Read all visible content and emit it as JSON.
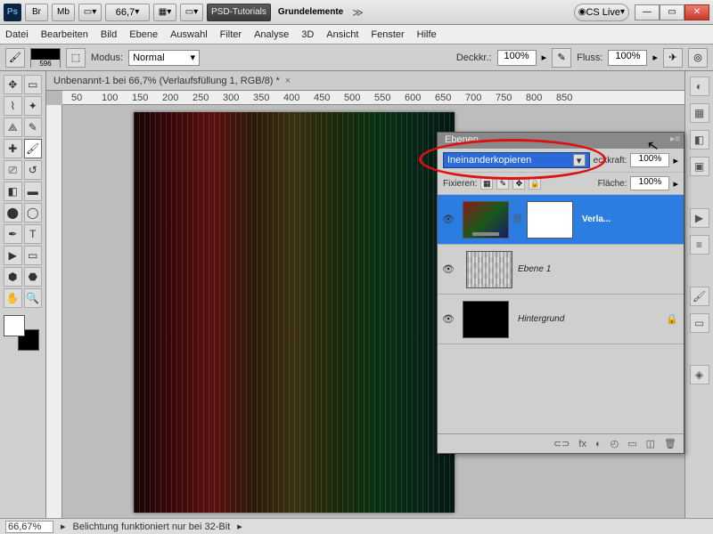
{
  "titlebar": {
    "ps": "Ps",
    "br": "Br",
    "mb": "Mb",
    "zoom": "66,7",
    "workspace_psd": "PSD-Tutorials",
    "workspace_grund": "Grundelemente",
    "cslive": "CS Live"
  },
  "menu": [
    "Datei",
    "Bearbeiten",
    "Bild",
    "Ebene",
    "Auswahl",
    "Filter",
    "Analyse",
    "3D",
    "Ansicht",
    "Fenster",
    "Hilfe"
  ],
  "options": {
    "swatch_num": "596",
    "modus_label": "Modus:",
    "modus_value": "Normal",
    "deckk_label": "Deckkr.:",
    "deckk_value": "100%",
    "fluss_label": "Fluss:",
    "fluss_value": "100%"
  },
  "doc_tab": "Unbenannt-1 bei 66,7% (Verlaufsfüllung 1, RGB/8) *",
  "ruler_h": [
    "50",
    "100",
    "150",
    "200",
    "250",
    "300",
    "350",
    "400",
    "450",
    "500",
    "550",
    "600",
    "650",
    "700",
    "750",
    "800",
    "850"
  ],
  "layers_panel": {
    "tab": "Ebenen",
    "blend_mode": "Ineinanderkopieren",
    "deckkraft_label": "eckkraft:",
    "deckkraft_value": "100%",
    "fixieren_label": "Fixieren:",
    "flaeche_label": "Fläche:",
    "flaeche_value": "100%",
    "layers": [
      {
        "name": "Verla..."
      },
      {
        "name": "Ebene 1"
      },
      {
        "name": "Hintergrund"
      }
    ],
    "footer_icons": [
      "⊂⊃",
      "fx",
      "◐",
      "◴",
      "▭",
      "◫",
      "🗑"
    ]
  },
  "status": {
    "zoom": "66,67%",
    "msg": "Belichtung funktioniert nur bei 32-Bit"
  }
}
